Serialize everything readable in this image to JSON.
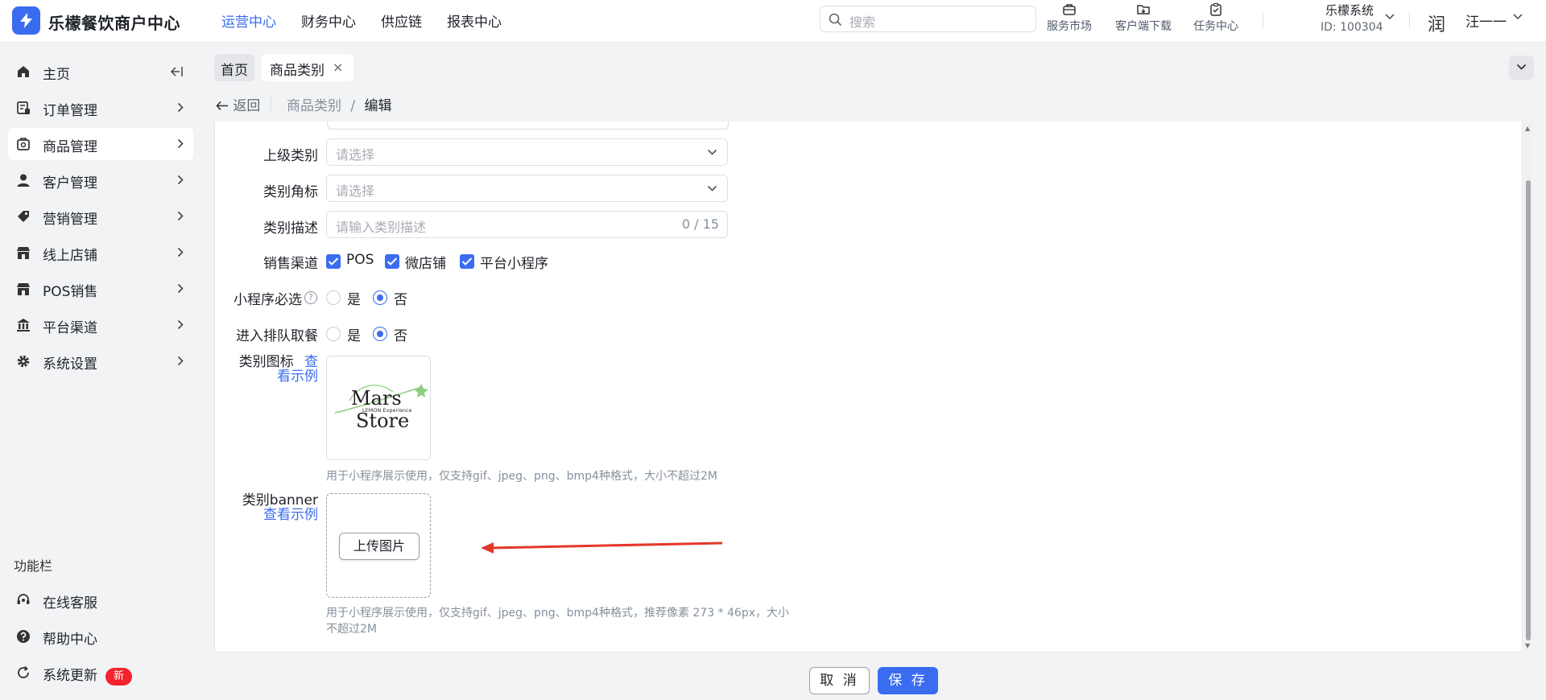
{
  "header": {
    "brand": "乐檬餐饮商户中心",
    "nav": [
      "运营中心",
      "财务中心",
      "供应链",
      "报表中心"
    ],
    "search_placeholder": "搜索",
    "tools": [
      "服务市场",
      "客户端下载",
      "任务中心"
    ],
    "system_name": "乐檬系统",
    "system_id": "ID: 100304",
    "avatar_char": "润",
    "user_name": "汪一一"
  },
  "sidebar": {
    "items": [
      "主页",
      "订单管理",
      "商品管理",
      "客户管理",
      "营销管理",
      "线上店铺",
      "POS销售",
      "平台渠道",
      "系统设置"
    ],
    "section_label": "功能栏",
    "footer_items": [
      "在线客服",
      "帮助中心",
      "系统更新"
    ],
    "new_badge": "新"
  },
  "tabs": {
    "home": "首页",
    "current": "商品类别",
    "close": "×"
  },
  "breadcrumb": {
    "back": "返回",
    "parent": "商品类别",
    "sep": "/",
    "current": "编辑"
  },
  "form": {
    "parent_category": {
      "label": "上级类别",
      "placeholder": "请选择"
    },
    "category_badge": {
      "label": "类别角标",
      "placeholder": "请选择"
    },
    "category_desc": {
      "label": "类别描述",
      "placeholder": "请输入类别描述",
      "count": "0 / 15"
    },
    "sales_channel": {
      "label": "销售渠道",
      "options": [
        "POS",
        "微店铺",
        "平台小程序"
      ]
    },
    "mini_required": {
      "label": "小程序必选",
      "help": "?",
      "options": [
        "是",
        "否"
      ],
      "selected": "否"
    },
    "queue": {
      "label": "进入排队取餐",
      "options": [
        "是",
        "否"
      ],
      "selected": "否"
    },
    "icon": {
      "label": "类别图标",
      "example_link_1": "查",
      "example_link_2": "看示例",
      "hint": "用于小程序展示使用，仅支持gif、jpeg、png、bmp4种格式，大小不超过2M"
    },
    "banner": {
      "label": "类别banner",
      "example_link": "查看示例",
      "upload": "上传图片",
      "hint_line1": "用于小程序展示使用，仅支持gif、jpeg、png、bmp4种格式，推荐像素 273 * 46px，大小",
      "hint_line2": "不超过2M"
    }
  },
  "logo_image": {
    "line1": "Mars",
    "tag": "LEMON Experience",
    "line2": "Store"
  },
  "actions": {
    "cancel": "取 消",
    "save": "保 存"
  },
  "colors": {
    "primary": "#3a6cf0",
    "danger": "#f5222d",
    "arrow": "#e2392b"
  }
}
